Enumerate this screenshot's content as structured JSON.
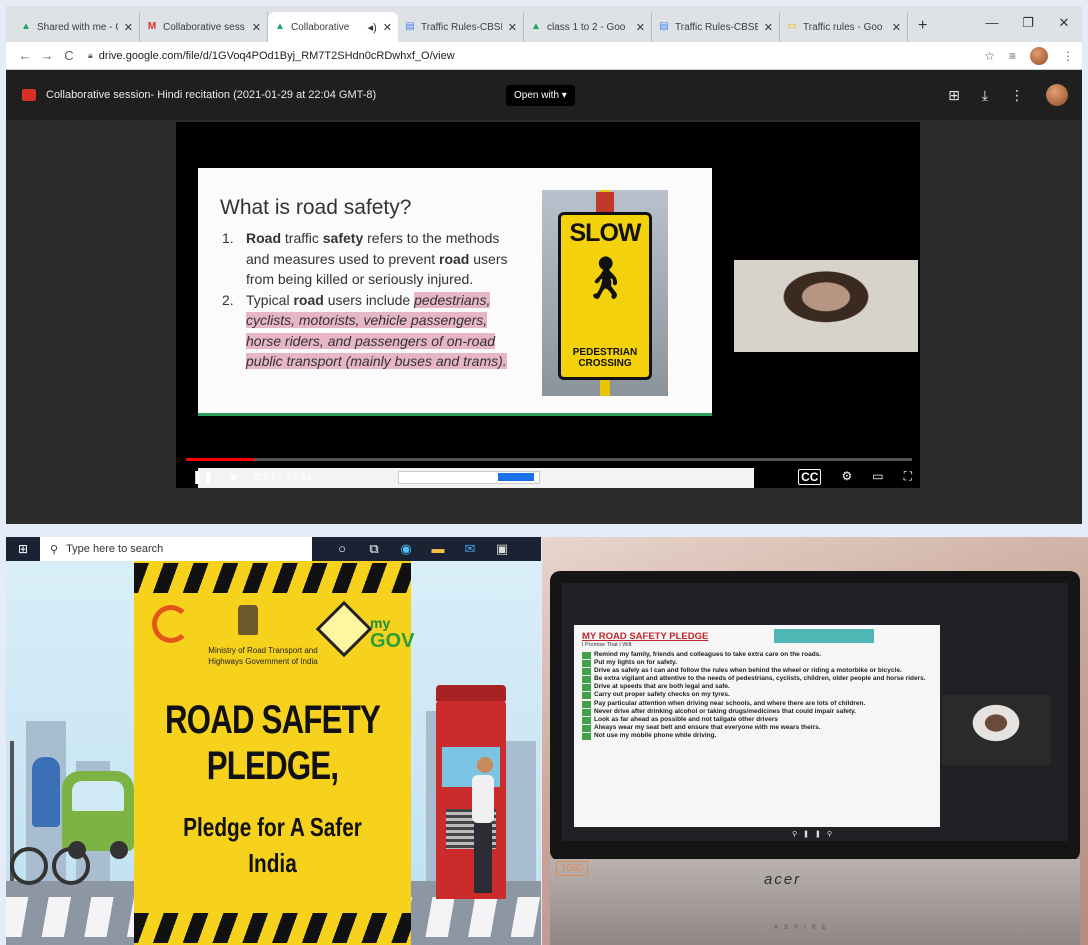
{
  "browser": {
    "tabs": [
      {
        "label": "Shared with me - G",
        "icon": "drive-icon",
        "active": false
      },
      {
        "label": "Collaborative sess",
        "icon": "gmail-icon",
        "active": false
      },
      {
        "label": "Collaborative",
        "icon": "drive-icon",
        "active": true
      },
      {
        "label": "Traffic Rules-CBSE",
        "icon": "docs-icon",
        "active": false
      },
      {
        "label": "class 1 to 2 - Goo",
        "icon": "drive-icon",
        "active": false
      },
      {
        "label": "Traffic Rules-CBSE",
        "icon": "docs-icon",
        "active": false
      },
      {
        "label": "Traffic rules - Goo",
        "icon": "slides-icon",
        "active": false
      }
    ],
    "url": "drive.google.com/file/d/1GVoq4POd1Byj_RM7T2SHdn0cRDwhxf_O/view"
  },
  "drive": {
    "file_title": "Collaborative session- Hindi recitation (2021-01-29 at 22:04 GMT-8)",
    "open_with": "Open with"
  },
  "slide": {
    "title": "What is road safety?",
    "items": [
      {
        "num": "1.",
        "text_plain": "Road traffic safety refers to the methods and measures used to prevent road users from being killed or seriously injured."
      },
      {
        "num": "2.",
        "text_lead": "Typical road users include ",
        "text_highlight": "pedestrians, cyclists, motorists, vehicle passengers, horse riders, and passengers of on-road public transport (mainly buses and trams)."
      }
    ],
    "sign_text": "SLOW",
    "sign_subtext": "PEDESTRIAN CROSSING"
  },
  "video": {
    "time": "2:53 / 30:41",
    "progress": 0.094,
    "cc_label": "CC"
  },
  "taskbar": {
    "search_placeholder": "Type here to search"
  },
  "poster": {
    "ministry": "Ministry of Road Transport and Highways Government of India",
    "headline1": "ROAD SAFETY PLEDGE,",
    "headline2": "Pledge for A Safer India",
    "mygov": "GOV",
    "mygov_prefix": "my"
  },
  "laptop": {
    "pledge_title": "MY ROAD SAFETY PLEDGE",
    "pledge_sub": "I Promise That I Will:",
    "pledge_items": [
      "Remind my family, friends and colleagues to take extra care on the roads.",
      "Put my lights on for safety.",
      "Drive as safely as I can and follow the rules when behind the wheel or riding a motorbike or bicycle.",
      "Be extra vigilant and attentive to the needs of pedestrians, cyclists, children, older people and horse riders.",
      "Drive at speeds that are both legal and safe.",
      "Carry out proper safety checks on my tyres.",
      "Pay particular attention when driving near schools, and where there are lots of children.",
      "Never drive after drinking alcohol or taking drugs/medicines that could impair safety.",
      "Look as far ahead as possible and not tailgate other drivers",
      "Always wear my seat belt and ensure that everyone with me wears theirs.",
      "Not use my mobile phone while driving."
    ],
    "brand": "acer",
    "model": "ASPIRE",
    "resolution_badge": "1080"
  },
  "colors": {
    "chrome_tabbar": "#dee1e6",
    "drive_bar": "#1f1f1f",
    "highlight": "#e7b6c6",
    "poster_yellow": "#f7d21c",
    "progress_red": "#ff0000",
    "pledge_red": "#c1272d",
    "check_green": "#42a047"
  }
}
